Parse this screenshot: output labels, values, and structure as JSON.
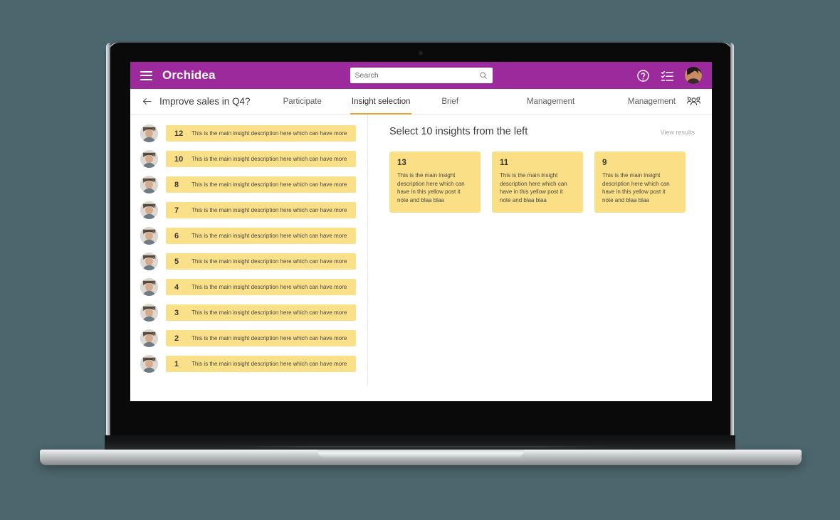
{
  "header": {
    "brand": "Orchidea",
    "menu_icon": "hamburger-icon",
    "search": {
      "placeholder": "Search",
      "value": "",
      "icon": "search-icon"
    },
    "help_icon": "help-circle-icon",
    "tasks_icon": "checklist-icon",
    "avatar": "user-avatar",
    "background_color": "#9c2a9c"
  },
  "nav": {
    "back_icon": "back-arrow-icon",
    "project_title": "Improve sales in Q4?",
    "tabs": [
      {
        "label": "Participate",
        "active": false
      },
      {
        "label": "Insight selection",
        "active": true
      },
      {
        "label": "Brief",
        "active": false
      },
      {
        "label": "Management",
        "active": false
      }
    ],
    "right_label": "Management",
    "people_icon": "people-group-icon",
    "active_underline_color": "#f0a030"
  },
  "insight_list": {
    "items": [
      {
        "number": "12",
        "text": "This is the main insight description here which can have more"
      },
      {
        "number": "10",
        "text": "This is the main insight description here which can have more"
      },
      {
        "number": "8",
        "text": "This is the main insight description here which can have more"
      },
      {
        "number": "7",
        "text": "This is the main insight description here which can have more"
      },
      {
        "number": "6",
        "text": "This is the main insight description here which can have more"
      },
      {
        "number": "5",
        "text": "This is the main insight description here which can have more"
      },
      {
        "number": "4",
        "text": "This is the main insight description here which can have more"
      },
      {
        "number": "3",
        "text": "This is the main insight description here which can have more"
      },
      {
        "number": "2",
        "text": "This is the main insight description here which can have more"
      },
      {
        "number": "1",
        "text": "This is the main insight description here which can have more"
      }
    ]
  },
  "selection_panel": {
    "title": "Select 10 insights from the left",
    "view_results_label": "View results",
    "cards": [
      {
        "number": "13",
        "text": "This is the main insight description here which can have in this yellow post it note and blaa blaa"
      },
      {
        "number": "11",
        "text": "This is the main insight description here which can have in this yellow post it note and blaa blaa"
      },
      {
        "number": "9",
        "text": "This is the main insight description here which can have in this yellow post it note and blaa blaa"
      }
    ],
    "postit_color": "#fbdf87"
  }
}
